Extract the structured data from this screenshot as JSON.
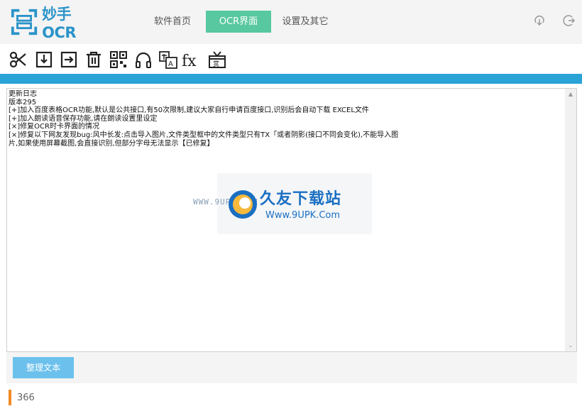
{
  "app": {
    "title": "妙手OCR",
    "accent_color": "#2aa3d6",
    "active_tab_color": "#58c8a0"
  },
  "nav": {
    "tabs": [
      {
        "label": "软件首页",
        "active": false
      },
      {
        "label": "OCR界面",
        "active": true
      },
      {
        "label": "设置及其它",
        "active": false
      }
    ]
  },
  "top_icons": [
    "download-icon",
    "exit-icon"
  ],
  "toolbar": {
    "tools": [
      "screenshot-icon",
      "import-icon",
      "export-icon",
      "delete-icon",
      "qrcode-icon",
      "headphones-icon",
      "translate-icon",
      "formula-icon",
      "reward-icon"
    ]
  },
  "editor": {
    "content": "更新日志\n版本295\n[+]加入百度表格OCR功能,默认是公共接口,有50次限制,建议大家自行申请百度接口,识别后会自动下载 EXCEL文件\n[+]加入朗读语音保存功能,请在朗读设置里设定\n[×]修复OCR时卡界面的情况\n[×]修复以下网友发现bug:风中长发:点击导入图片,文件类型框中的文件类型只有TX「或者阴影(接口不同会变化),不能导入图\n片,如果使用屏幕截图,会直接识别,但部分字母无法显示【已修复】"
  },
  "watermark": {
    "url": "WWW.9UPK.COM",
    "title": "久友下载站",
    "subtitle": "Www.9UPK.Com"
  },
  "actions": {
    "tidy_label": "整理文本"
  },
  "status": {
    "count": "366",
    "accent_color": "#f08a24"
  }
}
